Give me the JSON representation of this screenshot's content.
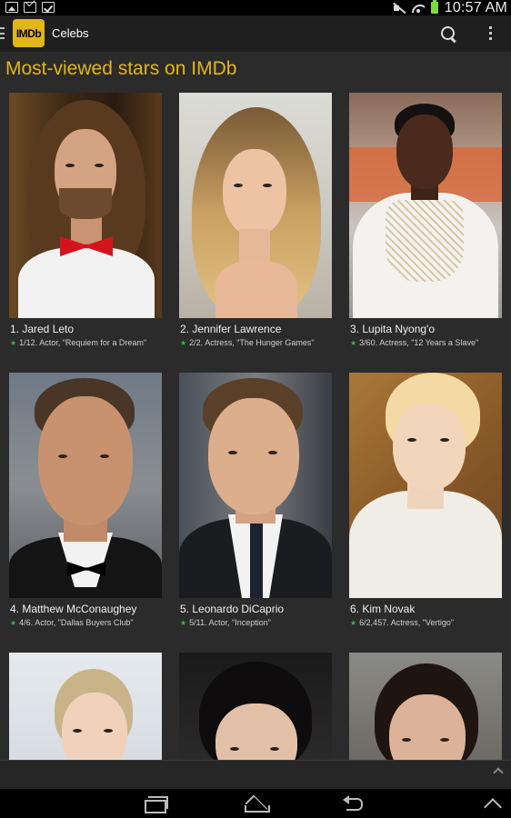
{
  "status_bar": {
    "time": "10:57 AM",
    "left_icons": [
      "image-icon",
      "mail-icon",
      "clipboard-check-icon"
    ],
    "right_icons": [
      "mute-icon",
      "wifi-icon",
      "battery-icon"
    ]
  },
  "action_bar": {
    "logo_text": "IMDb",
    "title": "Celebs",
    "actions": [
      "search-icon",
      "overflow-menu-icon"
    ]
  },
  "heading": "Most-viewed stars on IMDb",
  "stars": [
    {
      "name": "1. Jared Leto",
      "detail": "1/12. Actor, \"Requiem for a Dream\""
    },
    {
      "name": "2. Jennifer Lawrence",
      "detail": "2/2. Actress, \"The Hunger Games\""
    },
    {
      "name": "3. Lupita Nyong'o",
      "detail": "3/60. Actress, \"12 Years a Slave\""
    },
    {
      "name": "4. Matthew McConaughey",
      "detail": "4/6. Actor, \"Dallas Buyers Club\""
    },
    {
      "name": "5. Leonardo DiCaprio",
      "detail": "5/11. Actor, \"Inception\""
    },
    {
      "name": "6. Kim Novak",
      "detail": "6/2,457. Actress, \"Vertigo\""
    },
    {
      "name": "",
      "detail": ""
    },
    {
      "name": "",
      "detail": ""
    },
    {
      "name": "",
      "detail": ""
    }
  ],
  "colors": {
    "accent": "#e2b616",
    "background": "#2b2b2b",
    "star": "#37b24d"
  },
  "nav_bar": [
    "recent-apps-icon",
    "home-icon",
    "back-icon",
    "menu-up-icon"
  ]
}
